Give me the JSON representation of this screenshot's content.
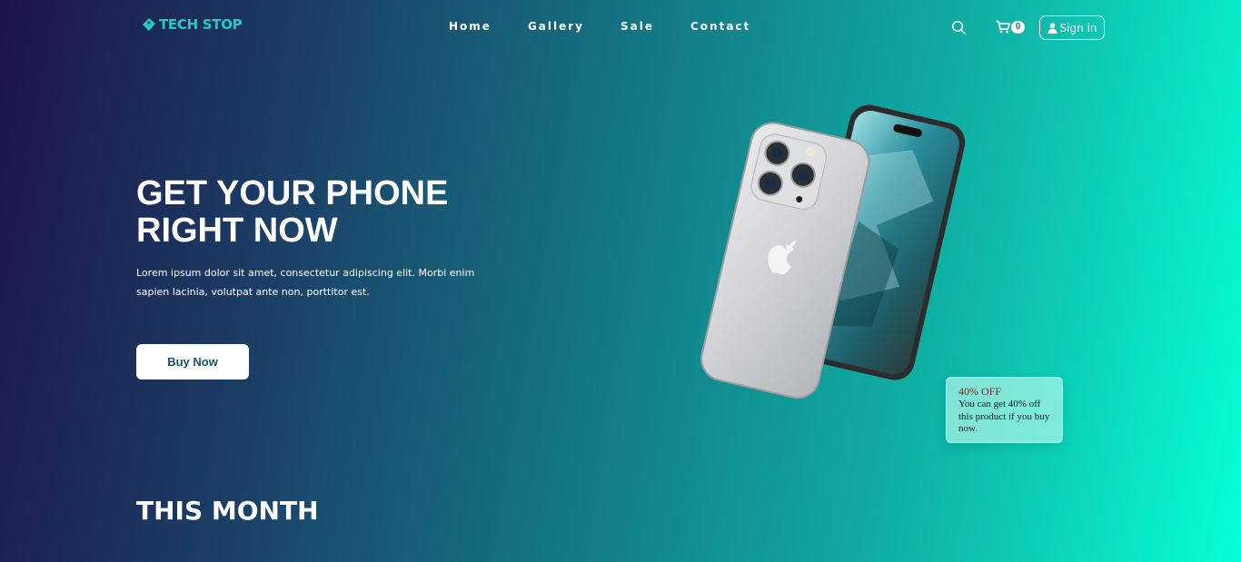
{
  "brand": {
    "name": "TECH STOP",
    "icon": "tag-icon",
    "color": "#22cdc0"
  },
  "nav": {
    "links": [
      "Home",
      "Gallery",
      "Sale",
      "Contact"
    ],
    "search_icon": "search-icon",
    "cart_icon": "cart-icon",
    "cart_count": "0",
    "signin_icon": "user-icon",
    "signin_label": "Sign in"
  },
  "hero": {
    "title_line1": "GET YOUR PHONE",
    "title_line2": "RIGHT NOW",
    "description": "Lorem ipsum dolor sit amet, consectetur adipiscing elit. Morbi enim sapien lacinia, volutpat ante non, porttitor est.",
    "cta_label": "Buy Now",
    "image": "smartphone-image"
  },
  "promo": {
    "title": "40% OFF",
    "text": "You can get 40% off this product if you buy now."
  },
  "section": {
    "title": "THIS MONTH"
  },
  "colors": {
    "gradient_start": "#1d1448",
    "gradient_end": "#06ffd6",
    "cta_text": "#1a5069",
    "promo_title": "#8b1c1c"
  }
}
